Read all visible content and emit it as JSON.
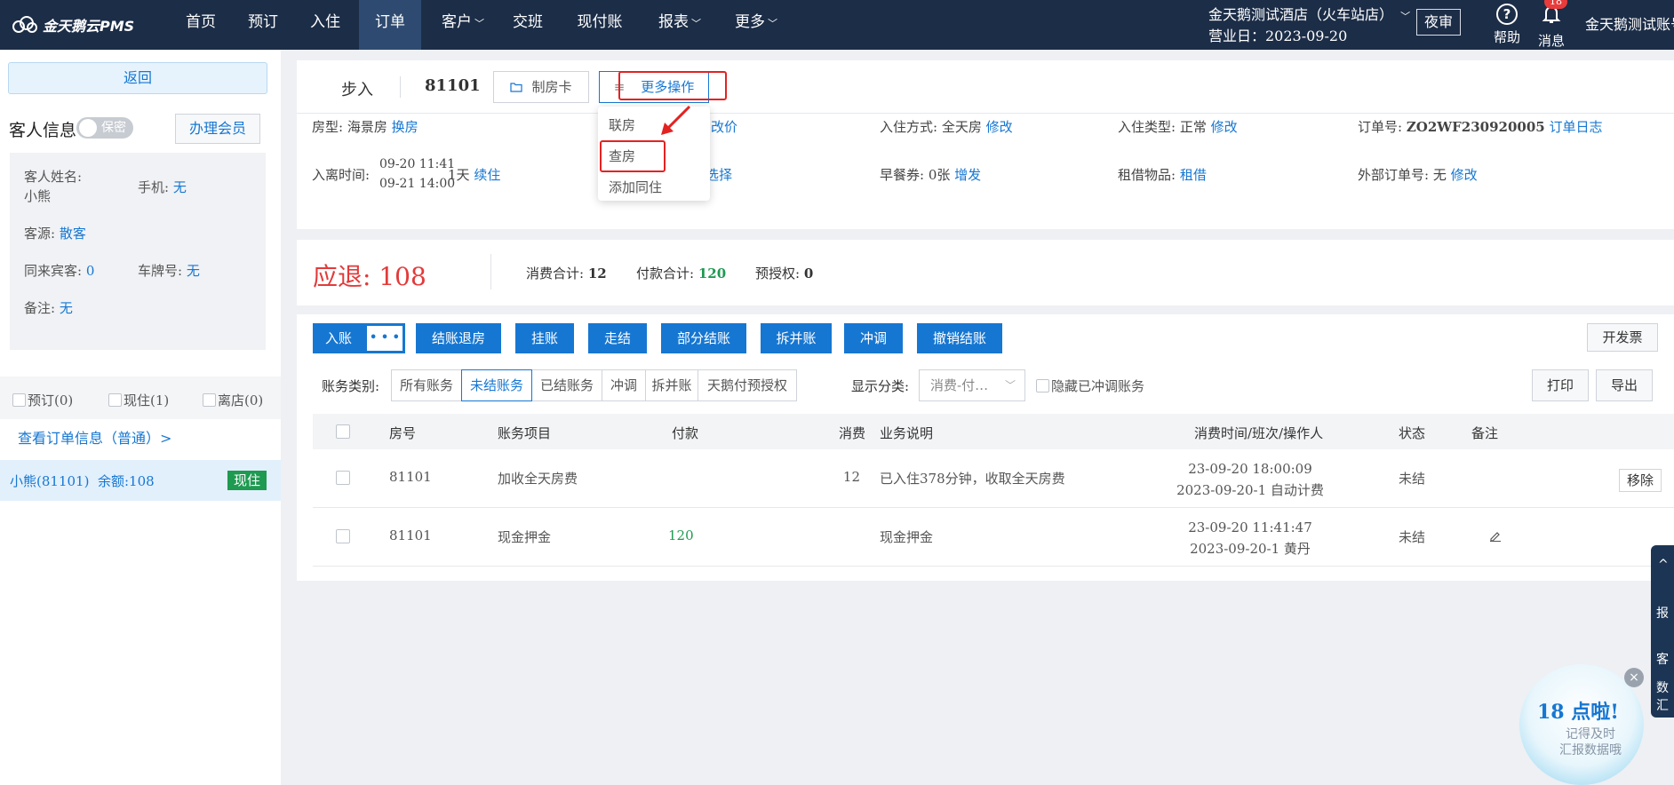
{
  "topnav": {
    "logo": "金天鹅云PMS",
    "items": [
      "首页",
      "预订",
      "入住",
      "订单",
      "客户",
      "交班",
      "现付账",
      "报表",
      "更多"
    ],
    "hotel": "金天鹅测试酒店（火车站店）",
    "business_day": "营业日：2023-09-20",
    "night_audit": "夜审",
    "help": "帮助",
    "message": "消息",
    "message_count": "18",
    "user": "金天鹅测试账号"
  },
  "left": {
    "back": "返回",
    "guest_title": "客人信息",
    "secret_toggle": "保密",
    "member_btn": "办理会员",
    "fields": {
      "name_label": "客人姓名:",
      "name_value": "小熊",
      "phone_label": "手机:",
      "phone_value": "无",
      "source_label": "客源:",
      "source_value": "散客",
      "companions_label": "同来宾客:",
      "companions_value": "0",
      "plate_label": "车牌号:",
      "plate_value": "无",
      "remark_label": "备注:",
      "remark_value": "无"
    },
    "filters": [
      "预订(0)",
      "现住(1)",
      "离店(0)"
    ],
    "order_link": "查看订单信息（普通）>",
    "order_entry": {
      "name": "小熊(81101)",
      "balance": "余额:108",
      "status": "现住"
    }
  },
  "header": {
    "step": "步入",
    "room": "81101",
    "make_card": "制房卡",
    "more_ops": "更多操作"
  },
  "dropdown": {
    "items": [
      "联房",
      "查房",
      "添加同住"
    ]
  },
  "info": {
    "room_type_label": "房型:",
    "room_type": "海景房",
    "change_room": "换房",
    "change_price": "改价",
    "checkin_mode_label": "入住方式:",
    "checkin_mode": "全天房",
    "modify": "修改",
    "checkin_type_label": "入住类型:",
    "checkin_type": "正常",
    "order_no_label": "订单号:",
    "order_no": "ZO2WF230920005",
    "order_log": "订单日志",
    "time_label": "入离时间:",
    "time_in": "09-20 11:41",
    "time_out": "09-21 14:00",
    "nights": "1天",
    "extend": "续住",
    "select": "选择",
    "breakfast_label": "早餐券:",
    "breakfast": "0张",
    "add_breakfast": "增发",
    "rental_label": "租借物品:",
    "rental": "租借",
    "ext_order_label": "外部订单号:",
    "ext_order": "无"
  },
  "summary": {
    "refund_label": "应退:",
    "refund_value": "108",
    "consume_label": "消费合计:",
    "consume_value": "12",
    "payment_label": "付款合计:",
    "payment_value": "120",
    "preauth_label": "预授权:",
    "preauth_value": "0"
  },
  "actions": {
    "entry": "入账",
    "entry_more": "• • •",
    "checkout": "结账退房",
    "hang": "挂账",
    "walk": "走结",
    "partial": "部分结账",
    "split_merge": "拆并账",
    "reverse": "冲调",
    "undo": "撤销结账",
    "invoice": "开发票",
    "print": "打印",
    "export": "导出"
  },
  "account_filter": {
    "label": "账务类别:",
    "segments": [
      "所有账务",
      "未结账务",
      "已结账务",
      "冲调",
      "拆并账",
      "天鹅付预授权"
    ],
    "active": "未结账务",
    "display_label": "显示分类:",
    "display_value": "消费-付…",
    "hide_void": "隐藏已冲调账务"
  },
  "table": {
    "headers": [
      "房号",
      "账务项目",
      "付款",
      "消费",
      "业务说明",
      "消费时间/班次/操作人",
      "状态",
      "备注"
    ],
    "rows": [
      {
        "room": "81101",
        "item": "加收全天房费",
        "payment": "",
        "consume": "12",
        "desc": "已入住378分钟，收取全天房费",
        "time": "23-09-20 18:00:09",
        "shift": "2023-09-20-1 自动计费",
        "status": "未结",
        "action": "移除"
      },
      {
        "room": "81101",
        "item": "现金押金",
        "payment": "120",
        "consume": "",
        "desc": "现金押金",
        "time": "23-09-20 11:41:47",
        "shift": "2023-09-20-1 黄丹",
        "status": "未结",
        "action": ""
      }
    ]
  },
  "side_float": {
    "items": [
      "报",
      "客",
      "数",
      "汇"
    ]
  },
  "promo": {
    "title": "18 点啦!",
    "line1": "记得及时",
    "line2": "汇报数据哦"
  },
  "colors": {
    "nav_bg": "#1c2d47",
    "primary": "#1677d2",
    "danger": "#e33a3a",
    "success": "#1e9a51"
  }
}
